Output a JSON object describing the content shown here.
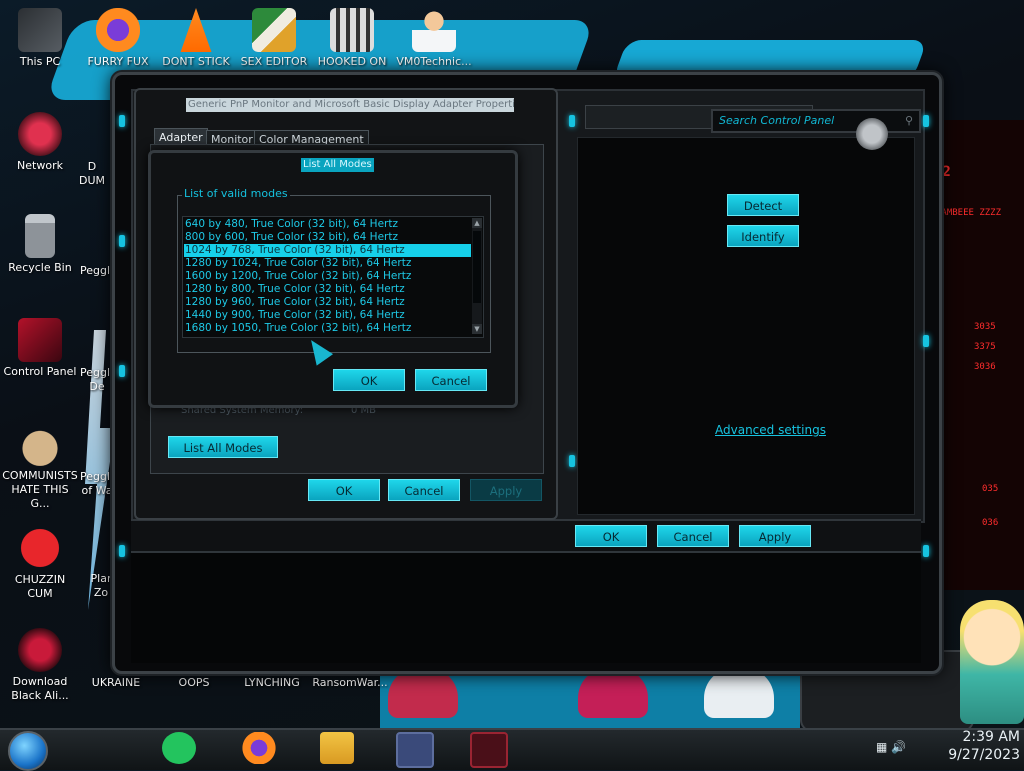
{
  "desktop": {
    "icons_col1": [
      {
        "label": "This PC",
        "icon": "computer-icon"
      },
      {
        "label": "Network",
        "icon": "network-icon"
      },
      {
        "label": "Recycle Bin",
        "icon": "recycle-bin-icon"
      },
      {
        "label": "Control Panel",
        "icon": "control-panel-icon"
      },
      {
        "label": "COMMUNISTS HATE THIS G...",
        "icon": "money-bag-icon"
      },
      {
        "label": "CHUZZIN CUM",
        "icon": "chuzzle-icon"
      },
      {
        "label": "Download Black Ali...",
        "icon": "alien-globe-icon"
      }
    ],
    "icons_top": [
      {
        "label": "FURRY FUX",
        "icon": "firefox-icon"
      },
      {
        "label": "DONT STICK",
        "icon": "vlc-cone-icon"
      },
      {
        "label": "SEX EDITOR",
        "icon": "hex-editor-icon"
      },
      {
        "label": "HOOKED ON",
        "icon": "maze-icon"
      },
      {
        "label": "VM0Technic...",
        "icon": "doctor-icon"
      }
    ],
    "icons_col2_partial": [
      "D",
      "DUM",
      "Peggle",
      "Peggle",
      "De",
      "Peggle",
      "of Wa",
      "Plar",
      "Zo"
    ],
    "icons_bottom": [
      {
        "label": "UKRAINE"
      },
      {
        "label": "OOPS"
      },
      {
        "label": "LYNCHING"
      },
      {
        "label": "RansomWar..."
      }
    ],
    "wallpaper_text": [
      "02",
      "RAMBEEE ZZZZ",
      "3035",
      "3375",
      "3036",
      "035",
      "036"
    ]
  },
  "control_panel": {
    "search_placeholder": "Search Control Panel",
    "detect_label": "Detect",
    "identify_label": "Identify",
    "advanced_link": "Advanced settings",
    "ok_label": "OK",
    "cancel_label": "Cancel",
    "apply_label": "Apply"
  },
  "adapter_props": {
    "title": "Generic PnP Monitor and Microsoft Basic Display Adapter Properties",
    "tabs": [
      "Adapter",
      "Monitor",
      "Color Management"
    ],
    "list_all_modes_label": "List All Modes",
    "ghost_row_left": "Shared System Memory:",
    "ghost_row_right": "0 MB",
    "ok_label": "OK",
    "cancel_label": "Cancel",
    "apply_label": "Apply"
  },
  "modes_dialog": {
    "title": "List All Modes",
    "group_label": "List of valid modes",
    "modes": [
      "640 by 480, True Color (32 bit), 64 Hertz",
      "800 by 600, True Color (32 bit), 64 Hertz",
      "1024 by 768, True Color (32 bit), 64 Hertz",
      "1280 by 1024, True Color (32 bit), 64 Hertz",
      "1600 by 1200, True Color (32 bit), 64 Hertz",
      "1280 by 800, True Color (32 bit), 64 Hertz",
      "1280 by 960, True Color (32 bit), 64 Hertz",
      "1440 by 900, True Color (32 bit), 64 Hertz",
      "1680 by 1050, True Color (32 bit), 64 Hertz"
    ],
    "selected_index": 2,
    "ok_label": "OK",
    "cancel_label": "Cancel"
  },
  "taskbar": {
    "items": [
      "start-orb-icon",
      "notes-app-icon",
      "firefox-icon",
      "file-explorer-icon",
      "display-settings-icon",
      "alienware-theme-icon"
    ],
    "time": "2:39 AM",
    "date": "9/27/2023"
  },
  "colors": {
    "accent": "#16c3e0",
    "selected_row": "#16d0ea",
    "wallpaper_red": "#ff2d2d"
  }
}
